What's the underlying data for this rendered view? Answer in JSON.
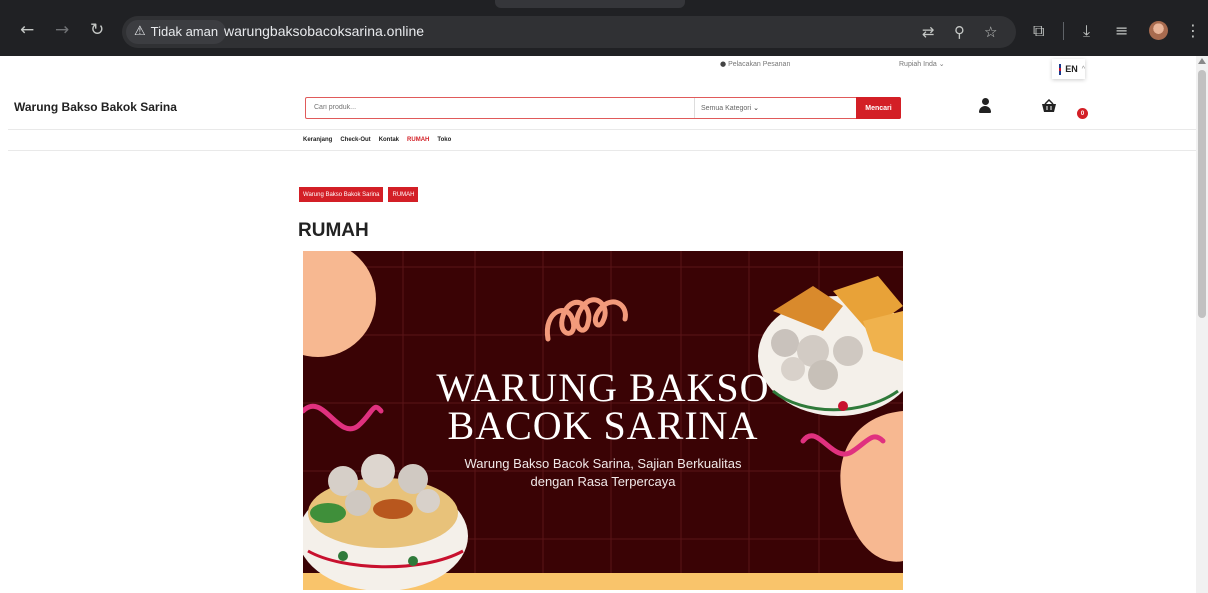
{
  "browser": {
    "security_label": "Tidak aman",
    "url": "warungbaksobacoksarina.online"
  },
  "topbar": {
    "order_tracking": "Pelacakan Pesanan",
    "currency": "Rupiah Inda",
    "language": "EN"
  },
  "header": {
    "logo": "Warung Bakso Bakok Sarina",
    "search_placeholder": "Cari produk...",
    "category_select": "Semua Kategori",
    "search_button": "Mencari",
    "cart_count": "0"
  },
  "menu": {
    "items": [
      "Keranjang",
      "Check-Out",
      "Kontak",
      "RUMAH",
      "Toko"
    ],
    "active_index": 3
  },
  "breadcrumb": [
    "Warung Bakso Bakok Sarina",
    "RUMAH"
  ],
  "page_title": "RUMAH",
  "banner": {
    "title_line1": "WARUNG BAKSO",
    "title_line2": "BACOK SARINA",
    "subtitle_line1": "Warung Bakso Bacok Sarina, Sajian Berkualitas",
    "subtitle_line2": "dengan Rasa Terpercaya",
    "colors": {
      "background": "#3a0305",
      "accent_pink": "#e0317f",
      "peach": "#f7b891",
      "yellow": "#f9c46b"
    }
  },
  "colors": {
    "brand_red": "#d31f26",
    "chrome_dark": "#202124"
  }
}
